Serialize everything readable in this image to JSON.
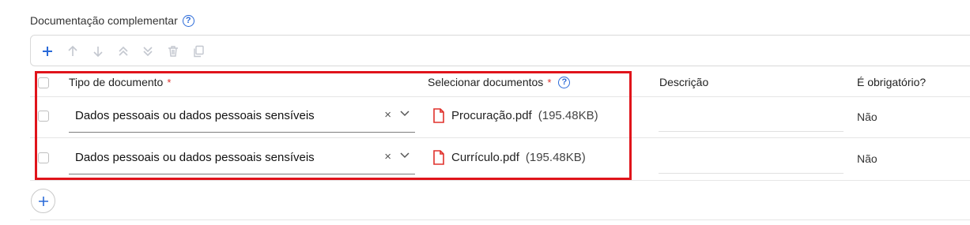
{
  "section": {
    "title": "Documentação complementar"
  },
  "toolbar": {
    "tools": [
      "add-icon",
      "move-up-icon",
      "move-down-icon",
      "move-top-icon",
      "move-bottom-icon",
      "delete-icon",
      "copy-icon"
    ]
  },
  "table": {
    "headers": {
      "tipo": "Tipo de documento",
      "selecionar": "Selecionar documentos",
      "descricao": "Descrição",
      "obrigatorio": "É obrigatório?"
    },
    "required_mark": "*",
    "rows": [
      {
        "tipo": "Dados pessoais ou dados pessoais sensíveis",
        "clear": "×",
        "file_name": "Procuração.pdf",
        "file_size": "(195.48KB)",
        "descricao": "",
        "obrigatorio": "Não"
      },
      {
        "tipo": "Dados pessoais ou dados pessoais sensíveis",
        "clear": "×",
        "file_name": "Currículo.pdf",
        "file_size": "(195.48KB)",
        "descricao": "",
        "obrigatorio": "Não"
      }
    ]
  },
  "colors": {
    "accent": "#2a6ad8",
    "required": "#e0312b",
    "highlight": "#e0141b",
    "pdf": "#e0312b"
  }
}
